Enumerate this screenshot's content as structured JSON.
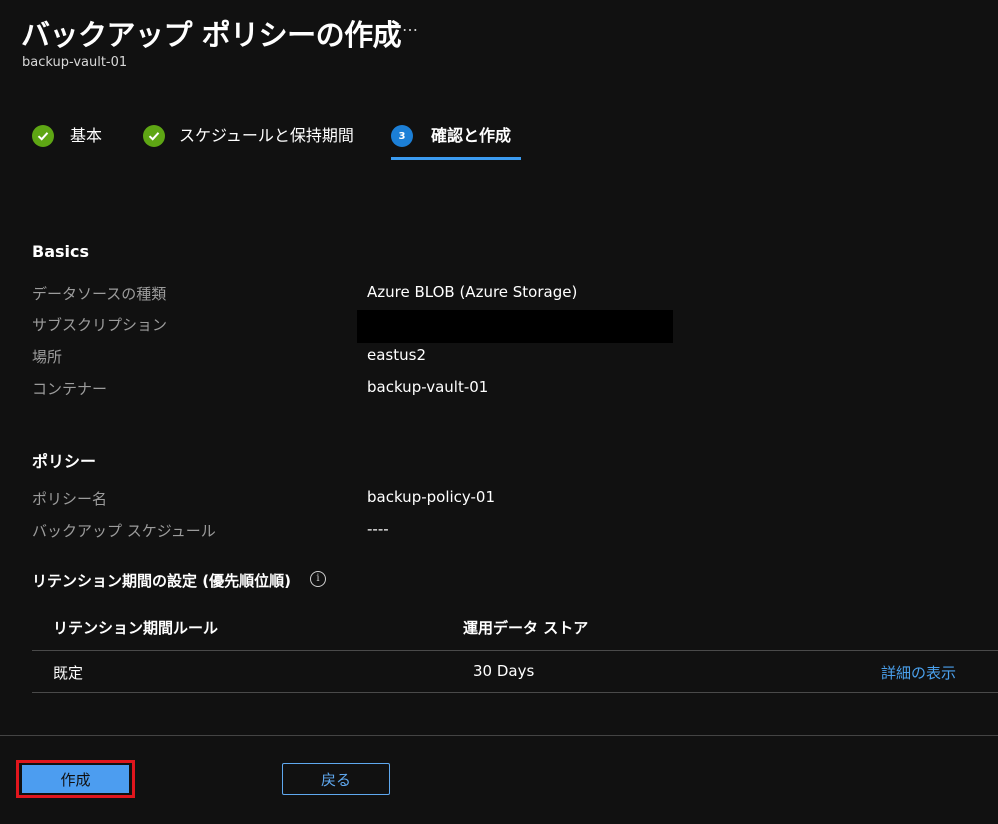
{
  "header": {
    "title": "バックアップ ポリシーの作成",
    "more_label": "…",
    "subtitle": "backup-vault-01"
  },
  "tabs": [
    {
      "label": "基本",
      "state": "done",
      "icon": "checkmark-icon"
    },
    {
      "label": "スケジュールと保持期間",
      "state": "done",
      "icon": "checkmark-icon"
    },
    {
      "label": "確認と作成",
      "state": "current",
      "step": "3"
    }
  ],
  "basics": {
    "heading": "Basics",
    "rows": [
      {
        "label": "データソースの種類",
        "value": "Azure BLOB (Azure Storage)"
      },
      {
        "label": "サブスクリプション",
        "value": ""
      },
      {
        "label": "場所",
        "value": "eastus2"
      },
      {
        "label": "コンテナー",
        "value": "backup-vault-01"
      }
    ]
  },
  "policy": {
    "heading": "ポリシー",
    "rows": [
      {
        "label": "ポリシー名",
        "value": "backup-policy-01"
      },
      {
        "label": "バックアップ スケジュール",
        "value": "----"
      }
    ]
  },
  "retention": {
    "heading": "リテンション期間の設定 (優先順位順)",
    "info_icon": "info-icon",
    "columns": [
      "リテンション期間ルール",
      "運用データ ストア"
    ],
    "rows": [
      {
        "rule": "既定",
        "store": "30 Days",
        "link": "詳細の表示"
      }
    ]
  },
  "footer": {
    "create_label": "作成",
    "back_label": "戻る"
  },
  "colors": {
    "background": "#111111",
    "done": "#5ea614",
    "accent": "#1c7fd6",
    "link": "#4aa0ec",
    "highlight_border": "#e0161d"
  }
}
